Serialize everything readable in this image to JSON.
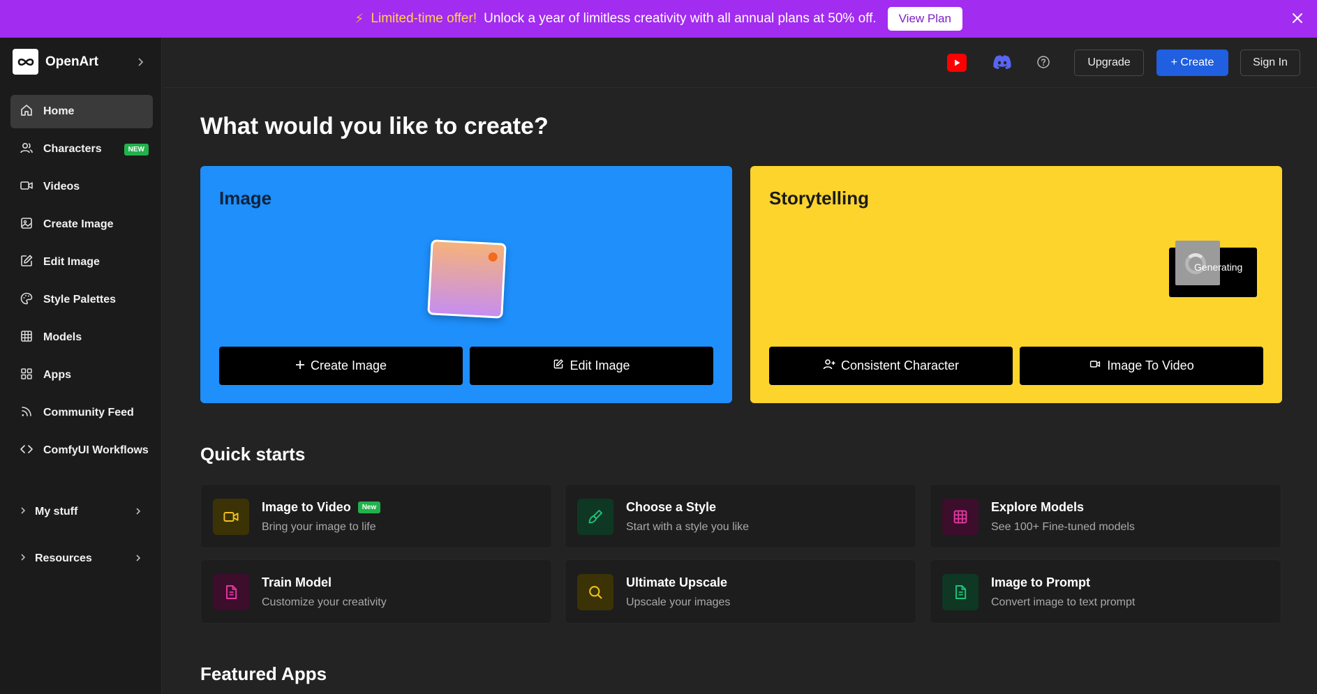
{
  "promo": {
    "highlight": "Limited-time offer!",
    "message": "Unlock a year of limitless creativity with all annual plans at 50% off.",
    "button": "View Plan"
  },
  "brand": {
    "name": "OpenArt"
  },
  "sidebar": {
    "items": [
      {
        "label": "Home",
        "icon": "home-icon",
        "active": true
      },
      {
        "label": "Characters",
        "icon": "users-icon",
        "badge": "NEW"
      },
      {
        "label": "Videos",
        "icon": "video-icon"
      },
      {
        "label": "Create Image",
        "icon": "image-icon"
      },
      {
        "label": "Edit Image",
        "icon": "edit-icon"
      },
      {
        "label": "Style Palettes",
        "icon": "palette-icon"
      },
      {
        "label": "Models",
        "icon": "grid-icon"
      },
      {
        "label": "Apps",
        "icon": "apps-icon"
      },
      {
        "label": "Community Feed",
        "icon": "rss-icon"
      },
      {
        "label": "ComfyUI Workflows",
        "icon": "code-icon"
      }
    ],
    "groups": [
      {
        "label": "My stuff"
      },
      {
        "label": "Resources"
      }
    ]
  },
  "topbar": {
    "upgrade": "Upgrade",
    "create": "Create",
    "sign_in": "Sign In"
  },
  "main": {
    "heading": "What would you like to create?",
    "image_card": {
      "title": "Image",
      "buttons": [
        "Create Image",
        "Edit Image"
      ]
    },
    "story_card": {
      "title": "Storytelling",
      "status": "Generating",
      "buttons": [
        "Consistent Character",
        "Image To Video"
      ]
    },
    "quick_starts_title": "Quick starts",
    "quick_starts": [
      {
        "title": "Image to Video",
        "badge": "New",
        "desc": "Bring your image to life",
        "icon": "video-icon",
        "color": "#f2c21b"
      },
      {
        "title": "Choose a Style",
        "desc": "Start with a style you like",
        "icon": "brush-icon",
        "color": "#22c27a"
      },
      {
        "title": "Explore Models",
        "desc": "See 100+ Fine-tuned models",
        "icon": "grid-icon",
        "color": "#e13aa0"
      },
      {
        "title": "Train Model",
        "desc": "Customize your creativity",
        "icon": "document-icon",
        "color": "#e13aa0"
      },
      {
        "title": "Ultimate Upscale",
        "desc": "Upscale your images",
        "icon": "search-icon",
        "color": "#f2c21b"
      },
      {
        "title": "Image to Prompt",
        "desc": "Convert image to text prompt",
        "icon": "document-icon",
        "color": "#22c27a"
      }
    ],
    "featured_title": "Featured Apps"
  },
  "colors": {
    "promo_bg": "#a22cf0",
    "image_card": "#1e8ffb",
    "story_card": "#fdd42b",
    "create_button": "#1f5fe0"
  }
}
